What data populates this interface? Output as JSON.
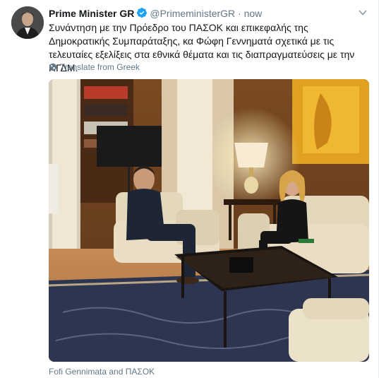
{
  "tweet": {
    "author_name": "Prime Minister GR",
    "author_handle": "@PrimeministerGR",
    "separator": "·",
    "timestamp": "now",
    "text": "Συνάντηση με την Πρόεδρο του ΠΑΣΟΚ και επικεφαλής της Δημοκρατικής Συμπαράταξης, κα Φώφη Γεννηματά σχετικά με τις τελευταίες εξελίξεις στα εθνικά θέματα και τις διαπραγματεύσεις με την ΠΓΔΜ.",
    "translate_label": "Translate from Greek",
    "media_caption": "Fofi Gennimata and ΠΑΣΟΚ"
  },
  "icons": {
    "verified": "verified-badge-icon",
    "globe": "globe-icon",
    "caret": "chevron-down-icon"
  },
  "colors": {
    "text_primary": "#14171a",
    "text_secondary": "#657786",
    "verified_blue": "#1da1f2"
  }
}
